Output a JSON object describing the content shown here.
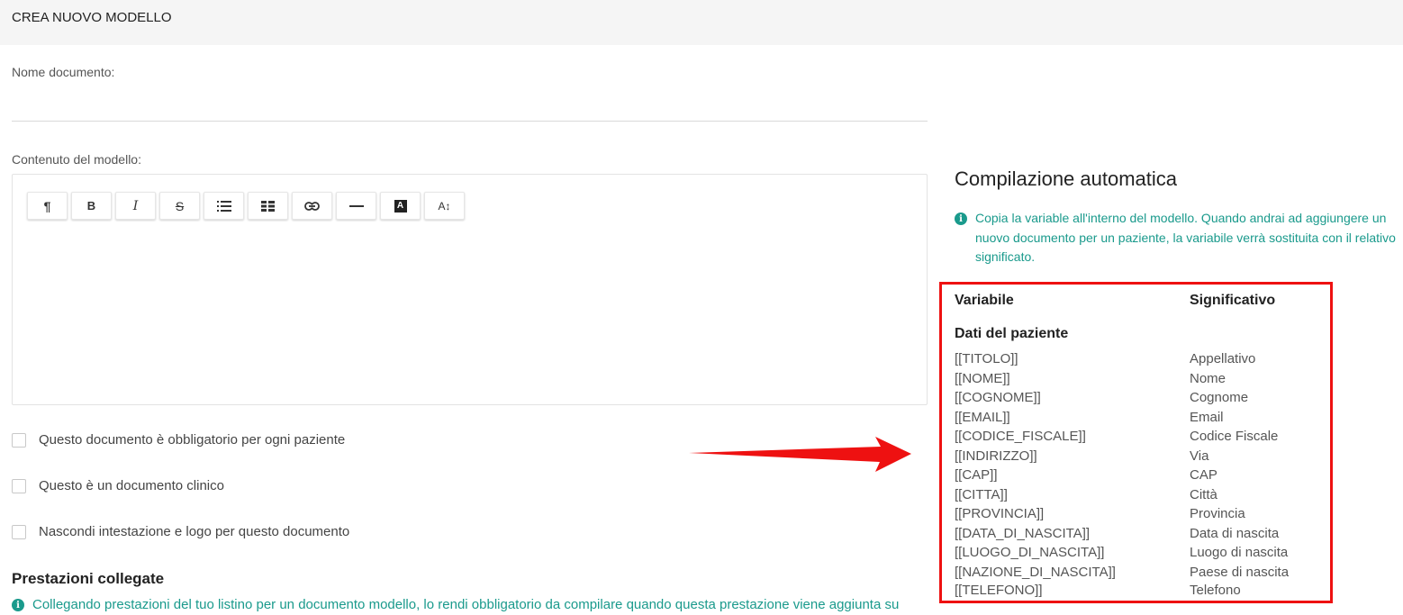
{
  "header": {
    "title": "CREA NUOVO MODELLO"
  },
  "form": {
    "doc_name_label": "Nome documento:",
    "doc_name_value": "",
    "content_label": "Contenuto del modello:",
    "toolbar": [
      {
        "name": "paragraph-icon",
        "glyph": "¶"
      },
      {
        "name": "bold-icon",
        "glyph": "B"
      },
      {
        "name": "italic-icon",
        "glyph": "I"
      },
      {
        "name": "strikethrough-icon",
        "glyph": "S"
      },
      {
        "name": "bullet-list-icon",
        "glyph": "list"
      },
      {
        "name": "table-icon",
        "glyph": "table"
      },
      {
        "name": "link-icon",
        "glyph": "link"
      },
      {
        "name": "horizontal-rule-icon",
        "glyph": "—"
      },
      {
        "name": "text-color-icon",
        "glyph": "A"
      },
      {
        "name": "font-size-icon",
        "glyph": "A↕"
      }
    ],
    "checkboxes": [
      {
        "label": "Questo documento è obbligatorio per ogni paziente",
        "checked": false
      },
      {
        "label": "Questo è un documento clinico",
        "checked": false
      },
      {
        "label": "Nascondi intestazione e logo per questo documento",
        "checked": false
      }
    ],
    "linked_title": "Prestazioni collegate",
    "linked_info": "Collegando prestazioni del tuo listino per un documento modello, lo rendi obbligatorio da compilare quando questa prestazione viene aggiunta su"
  },
  "autofill": {
    "title": "Compilazione automatica",
    "info": "Copia la variable all'interno del modello. Quando andrai ad aggiungere un nuovo documento per un paziente, la variabile verrà sostituita con il relativo significato.",
    "col_variable": "Variabile",
    "col_meaning": "Significativo",
    "group": "Dati del paziente",
    "rows": [
      {
        "var": "[[TITOLO]]",
        "meaning": "Appellativo"
      },
      {
        "var": "[[NOME]]",
        "meaning": "Nome"
      },
      {
        "var": "[[COGNOME]]",
        "meaning": "Cognome"
      },
      {
        "var": "[[EMAIL]]",
        "meaning": "Email"
      },
      {
        "var": "[[CODICE_FISCALE]]",
        "meaning": "Codice Fiscale"
      },
      {
        "var": "[[INDIRIZZO]]",
        "meaning": "Via"
      },
      {
        "var": "[[CAP]]",
        "meaning": "CAP"
      },
      {
        "var": "[[CITTA]]",
        "meaning": "Città"
      },
      {
        "var": "[[PROVINCIA]]",
        "meaning": "Provincia"
      },
      {
        "var": "[[DATA_DI_NASCITA]]",
        "meaning": "Data di nascita"
      },
      {
        "var": "[[LUOGO_DI_NASCITA]]",
        "meaning": "Luogo di nascita"
      },
      {
        "var": "[[NAZIONE_DI_NASCITA]]",
        "meaning": "Paese di nascita"
      },
      {
        "var": "[[TELEFONO]]",
        "meaning": "Telefono"
      }
    ]
  },
  "colors": {
    "accent": "#1a9a8c",
    "highlight": "#ee1111",
    "header_bg": "#f5f5f5"
  }
}
